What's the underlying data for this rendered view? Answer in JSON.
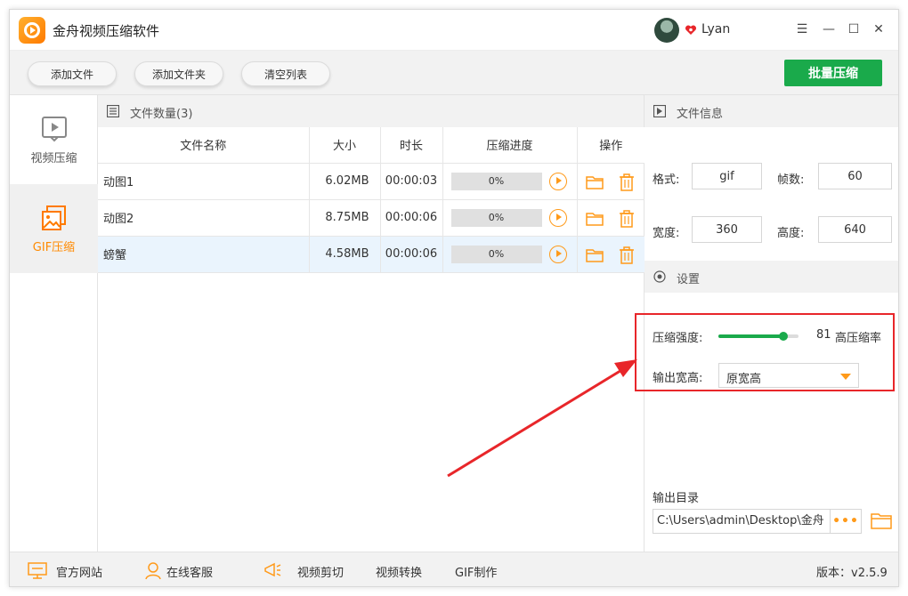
{
  "app": {
    "title": "金舟视频压缩软件",
    "username": "Lyan"
  },
  "window_controls": {
    "menu": "☰",
    "minimize": "—",
    "maximize": "☐",
    "close": "✕"
  },
  "toolbar": {
    "add_file": "添加文件",
    "add_folder": "添加文件夹",
    "clear_list": "清空列表",
    "batch_compress": "批量压缩"
  },
  "nav": {
    "items": [
      {
        "label": "视频压缩",
        "icon": "video-play-icon",
        "active": false
      },
      {
        "label": "GIF压缩",
        "icon": "image-icon",
        "active": true
      }
    ]
  },
  "file_list": {
    "header": "文件数量(3)",
    "columns": [
      "文件名称",
      "大小",
      "时长",
      "压缩进度",
      "操作"
    ],
    "rows": [
      {
        "name": "动图1",
        "size": "6.02MB",
        "duration": "00:00:03",
        "progress": 0,
        "progress_text": "0%",
        "selected": false
      },
      {
        "name": "动图2",
        "size": "8.75MB",
        "duration": "00:00:06",
        "progress": 0,
        "progress_text": "0%",
        "selected": false
      },
      {
        "name": "螃蟹",
        "size": "4.58MB",
        "duration": "00:00:06",
        "progress": 0,
        "progress_text": "0%",
        "selected": true
      }
    ]
  },
  "file_info": {
    "header": "文件信息",
    "format_label": "格式:",
    "format_value": "gif",
    "frames_label": "帧数:",
    "frames_value": "60",
    "width_label": "宽度:",
    "width_value": "360",
    "height_label": "高度:",
    "height_value": "640"
  },
  "settings": {
    "header": "设置",
    "strength_label": "压缩强度:",
    "strength_value": 81,
    "strength_value_text": "81",
    "strength_desc": "高压缩率",
    "output_size_label": "输出宽高:",
    "output_size_value": "原宽高",
    "output_dir_label": "输出目录",
    "output_dir_value": "C:\\Users\\admin\\Desktop\\金舟",
    "more_label": "•••"
  },
  "statusbar": {
    "website": "官方网站",
    "support": "在线客服",
    "video_cut": "视频剪切",
    "video_convert": "视频转换",
    "gif_make": "GIF制作",
    "version": "版本：v2.5.9"
  },
  "colors": {
    "accent_green": "#1aaa4b",
    "accent_orange": "#ff9a1a",
    "annotation_red": "#e8262a"
  }
}
